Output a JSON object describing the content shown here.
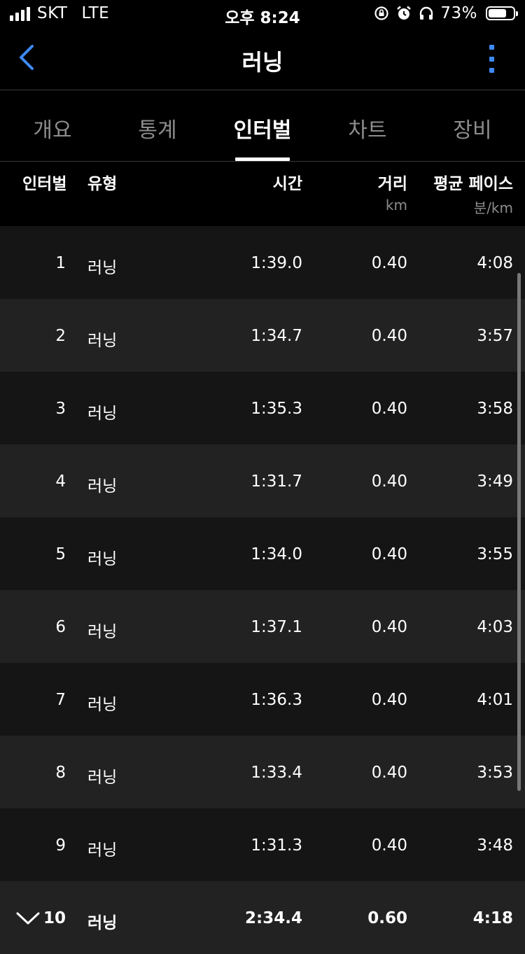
{
  "status_bar": {
    "carrier": "SKT",
    "network": "LTE",
    "time": "오후 8:24",
    "battery_percent": "73%",
    "battery_level": 0.73
  },
  "nav": {
    "title": "러닝"
  },
  "tabs": [
    {
      "label": "개요",
      "active": false
    },
    {
      "label": "통계",
      "active": false
    },
    {
      "label": "인터벌",
      "active": true
    },
    {
      "label": "차트",
      "active": false
    },
    {
      "label": "장비",
      "active": false
    }
  ],
  "table": {
    "headers": {
      "interval": "인터벌",
      "type": "유형",
      "time": "시간",
      "distance": "거리",
      "distance_unit": "km",
      "pace": "평균 페이스",
      "pace_unit": "분/km"
    },
    "rows": [
      {
        "num": "1",
        "type": "러닝",
        "time": "1:39.0",
        "distance": "0.40",
        "pace": "4:08"
      },
      {
        "num": "2",
        "type": "러닝",
        "time": "1:34.7",
        "distance": "0.40",
        "pace": "3:57"
      },
      {
        "num": "3",
        "type": "러닝",
        "time": "1:35.3",
        "distance": "0.40",
        "pace": "3:58"
      },
      {
        "num": "4",
        "type": "러닝",
        "time": "1:31.7",
        "distance": "0.40",
        "pace": "3:49"
      },
      {
        "num": "5",
        "type": "러닝",
        "time": "1:34.0",
        "distance": "0.40",
        "pace": "3:55"
      },
      {
        "num": "6",
        "type": "러닝",
        "time": "1:37.1",
        "distance": "0.40",
        "pace": "4:03"
      },
      {
        "num": "7",
        "type": "러닝",
        "time": "1:36.3",
        "distance": "0.40",
        "pace": "4:01"
      },
      {
        "num": "8",
        "type": "러닝",
        "time": "1:33.4",
        "distance": "0.40",
        "pace": "3:53"
      },
      {
        "num": "9",
        "type": "러닝",
        "time": "1:31.3",
        "distance": "0.40",
        "pace": "3:48"
      }
    ],
    "summary_row": {
      "num": "10",
      "type": "러닝",
      "time": "2:34.4",
      "distance": "0.60",
      "pace": "4:18"
    }
  },
  "colors": {
    "accent": "#3d8af7",
    "background": "#000000",
    "row_odd": "#151515",
    "row_even": "#222222",
    "muted_text": "#8d8d8d"
  },
  "icons": [
    "back-chevron-icon",
    "more-vertical-icon",
    "signal-icon",
    "rotation-lock-icon",
    "alarm-icon",
    "headphones-icon",
    "battery-icon",
    "chevron-down-icon"
  ]
}
